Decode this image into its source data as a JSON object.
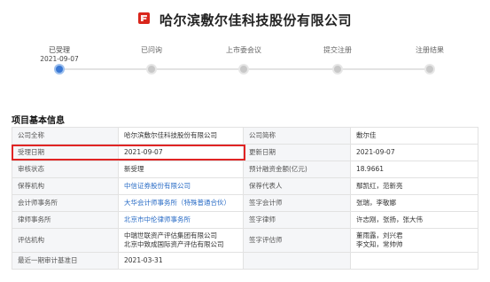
{
  "header": {
    "title": "哈尔滨敷尔佳科技股份有限公司"
  },
  "progress": {
    "steps": [
      {
        "label": "已受理",
        "date": "2021-09-07",
        "active": true
      },
      {
        "label": "已问询",
        "date": "",
        "active": false
      },
      {
        "label": "上市委会议",
        "date": "",
        "active": false
      },
      {
        "label": "提交注册",
        "date": "",
        "active": false
      },
      {
        "label": "注册结果",
        "date": "",
        "active": false
      }
    ]
  },
  "section": {
    "title": "项目基本信息"
  },
  "info": {
    "rows": [
      {
        "k1": "公司全称",
        "v1": "哈尔滨敷尔佳科技股份有限公司",
        "k2": "公司简称",
        "v2": "敷尔佳"
      },
      {
        "k1": "受理日期",
        "v1": "2021-09-07",
        "k2": "更新日期",
        "v2": "2021-09-07"
      },
      {
        "k1": "审核状态",
        "v1": "新受理",
        "k2": "预计融资金额(亿元)",
        "v2": "18.9661"
      },
      {
        "k1": "保荐机构",
        "v1": "中信证券股份有限公司",
        "k2": "保荐代表人",
        "v2": "鄢凯红，范新亮"
      },
      {
        "k1": "会计师事务所",
        "v1": "大华会计师事务所（特殊普通合伙）",
        "k2": "签字会计师",
        "v2": "张瑞，李敬娜"
      },
      {
        "k1": "律师事务所",
        "v1": "北京市中伦律师事务所",
        "k2": "签字律师",
        "v2": "许志刚，张扬，张大伟"
      },
      {
        "k1": "评估机构",
        "v1a": "中瑞世联资产评估集团有限公司",
        "v1b": "北京中致成国际资产评估有限公司",
        "k2": "签字评估师",
        "v2a": "董雨露，刘兴君",
        "v2b": "李文知，常帅帅"
      },
      {
        "k1": "最近一期审计基准日",
        "v1": "2021-03-31",
        "k2": "",
        "v2": ""
      }
    ]
  }
}
